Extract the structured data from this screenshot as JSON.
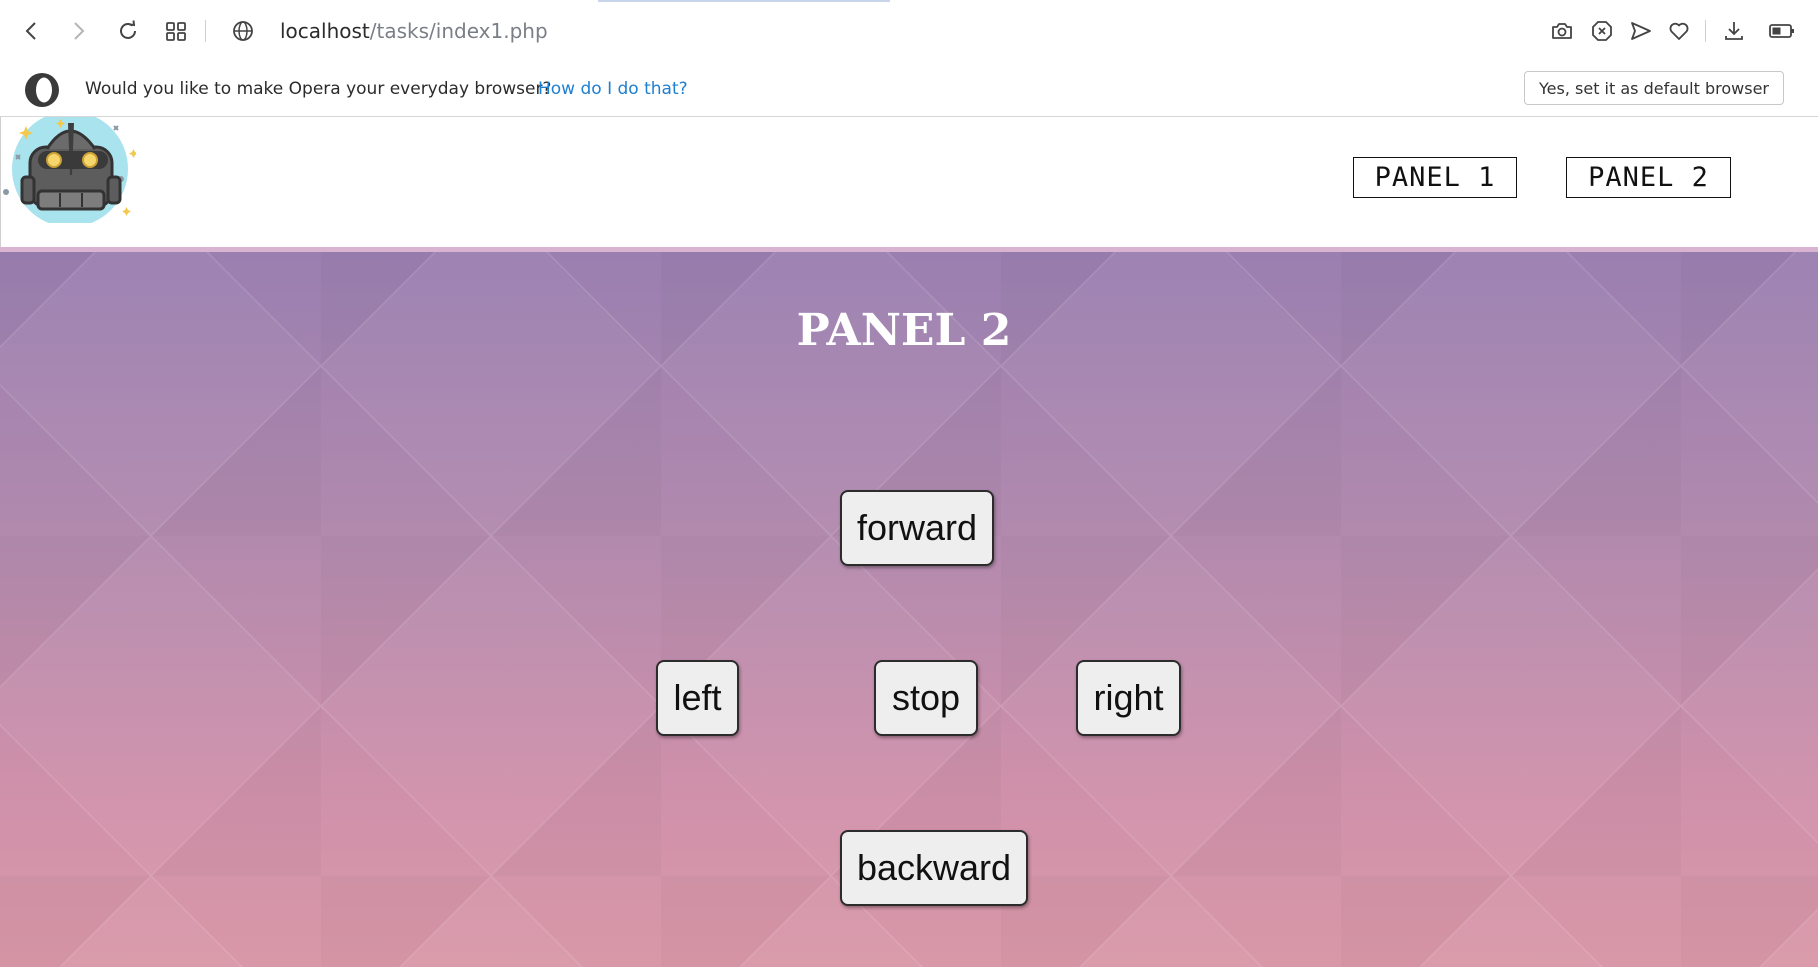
{
  "browser": {
    "url_host": "localhost",
    "url_path": "/tasks/index1.php",
    "toolbar_icons": [
      "back-icon",
      "forward-icon",
      "reload-icon",
      "tabs-grid-icon",
      "globe-icon",
      "camera-icon",
      "adblock-icon",
      "send-icon",
      "heart-icon",
      "download-icon",
      "battery-icon"
    ]
  },
  "infobar": {
    "message": "Would you like to make Opera your everyday browser?",
    "link": "How do I do that?",
    "button": "Yes, set it as default browser"
  },
  "header": {
    "logo": "robot-logo",
    "nav": [
      {
        "label": "PANEL 1"
      },
      {
        "label": "PANEL 2"
      }
    ]
  },
  "panel": {
    "title": "PANEL 2",
    "controls": {
      "forward": "forward",
      "left": "left",
      "stop": "stop",
      "right": "right",
      "backward": "backward"
    }
  }
}
